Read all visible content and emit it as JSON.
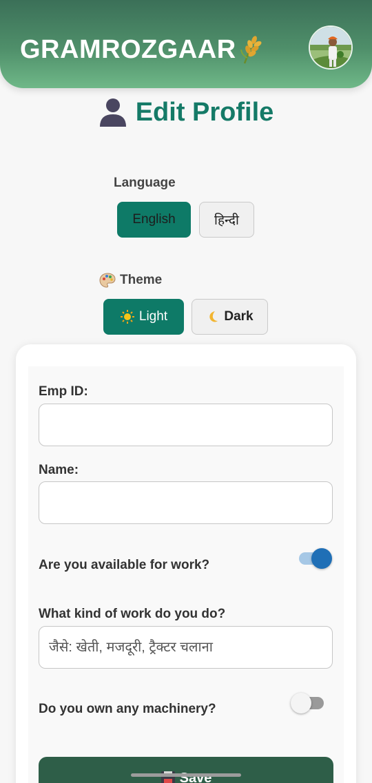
{
  "header": {
    "app_title": "GRAMROZGAAR",
    "wheat_icon": "wheat-icon",
    "avatar_icon": "farmer-avatar"
  },
  "page": {
    "title": "Edit Profile",
    "title_icon": "user-silhouette-icon"
  },
  "language": {
    "label": "Language",
    "options": [
      "English",
      "हिन्दी"
    ],
    "selected": "English"
  },
  "theme": {
    "label": "Theme",
    "label_icon": "palette-icon",
    "options": [
      "Light",
      "Dark"
    ],
    "option_icons": [
      "sun-icon",
      "moon-icon"
    ],
    "selected": "Light"
  },
  "form": {
    "emp_id_label": "Emp ID:",
    "emp_id_value": "",
    "name_label": "Name:",
    "name_value": "",
    "available_label": "Are you available for work?",
    "available_value": true,
    "work_label": "What kind of work do you do?",
    "work_placeholder": "जैसे: खेती, मजदूरी, ट्रैक्टर चलाना",
    "machinery_label": "Do you own any machinery?",
    "machinery_value": false,
    "save_label": "Save",
    "save_icon": "floppy-disk-icon"
  },
  "colors": {
    "brand_green": "#0e7a67",
    "header_gradient_top": "#3b7058",
    "header_gradient_bottom": "#6fb888",
    "toggle_on": "#1f6fb6",
    "save_button": "#2e5e48"
  }
}
